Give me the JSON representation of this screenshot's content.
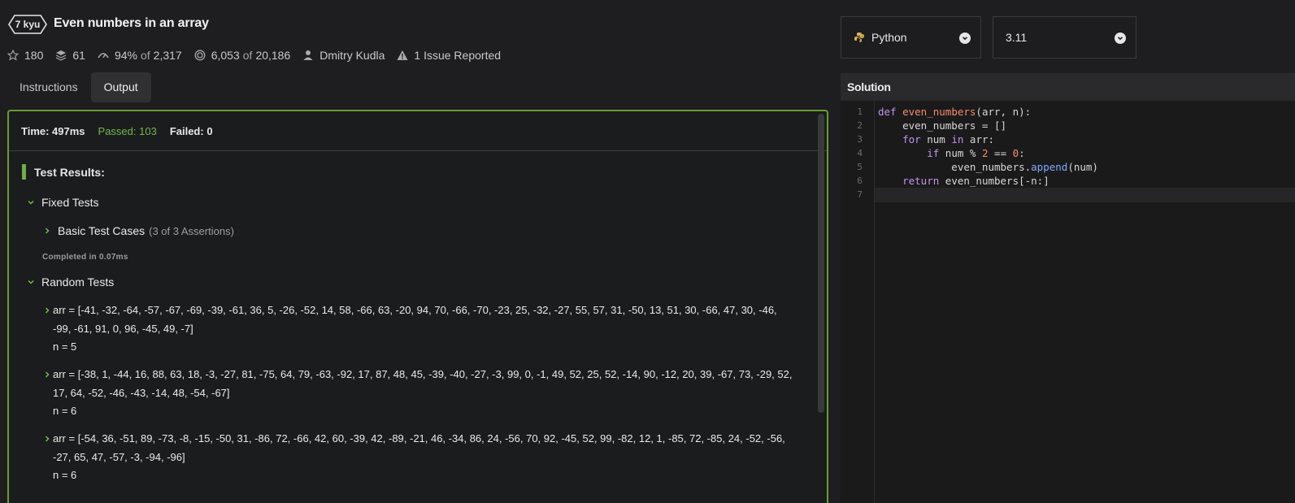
{
  "kata": {
    "rank": "7 kyu",
    "title": "Even numbers in an array"
  },
  "stats": {
    "stars": "180",
    "collections": "61",
    "satisfaction": "94%",
    "satisfaction_of": "of",
    "satisfaction_total": "2,317",
    "completions": "6,053",
    "completions_of": "of",
    "completions_total": "20,186",
    "author": "Dmitry Kudla",
    "issues": "1 Issue Reported"
  },
  "tabs": [
    {
      "label": "Instructions",
      "active": false
    },
    {
      "label": "Output",
      "active": true
    }
  ],
  "output": {
    "time": "Time: 497ms",
    "passed": "Passed: 103",
    "failed": "Failed: 0",
    "results_title": "Test Results:",
    "fixed_group": "Fixed Tests",
    "basic_cases": "Basic Test Cases",
    "basic_assertions": "(3 of 3 Assertions)",
    "completed": "Completed in 0.07ms",
    "random_group": "Random Tests",
    "cases": [
      {
        "arr1": "arr = [-41, -32, -64, -57, -67, -69, -39, -61, 36, 5, -26, -52, 14, 58, -66, 63, -20, 94, 70, -66, -70, -23, 25, -32, -27, 55, 57, 31, -50, 13, 51, 30, -66, 47, 30, -46,",
        "arr2": "-99, -61, 91, 0, 96, -45, 49, -7]",
        "n": "n = 5"
      },
      {
        "arr1": "arr = [-38, 1, -44, 16, 88, 63, 18, -3, -27, 81, -75, 64, 79, -63, -92, 17, 87, 48, 45, -39, -40, -27, -3, 99, 0, -1, 49, 52, 25, 52, -14, 90, -12, 20, 39, -67, 73, -29, 52,",
        "arr2": "17, 64, -52, -46, -43, -14, 48, -54, -67]",
        "n": "n = 6"
      },
      {
        "arr1": "arr = [-54, 36, -51, 89, -73, -8, -15, -50, 31, -86, 72, -66, 42, 60, -39, 42, -89, -21, 46, -34, 86, 24, -56, 70, 92, -45, 52, 99, -82, 12, 1, -85, 72, -85, 24, -52, -56,",
        "arr2": "-27, 65, 47, -57, -3, -94, -96]",
        "n": "n = 6"
      }
    ]
  },
  "editor": {
    "language": "Python",
    "version": "3.11",
    "solution_title": "Solution",
    "line_numbers": [
      "1",
      "2",
      "3",
      "4",
      "5",
      "6",
      "7"
    ],
    "tokens": {
      "l1_kw": "def",
      "l1_fn": "even_numbers",
      "l1_rest": "(arr, n):",
      "l2": "    even_numbers = []",
      "l3_ind": "    ",
      "l3_kw1": "for",
      "l3_mid": " num ",
      "l3_kw2": "in",
      "l3_rest": " arr:",
      "l4_ind": "        ",
      "l4_kw": "if",
      "l4_mid": " num ",
      "l4_op": "%",
      "l4_sp": " ",
      "l4_n2": "2",
      "l4_eq": " == ",
      "l4_n0": "0",
      "l4_end": ":",
      "l5_ind": "            even_numbers.",
      "l5_meth": "append",
      "l5_rest": "(num)",
      "l6_ind": "    ",
      "l6_kw": "return",
      "l6_rest": " even_numbers[-n:]"
    }
  }
}
